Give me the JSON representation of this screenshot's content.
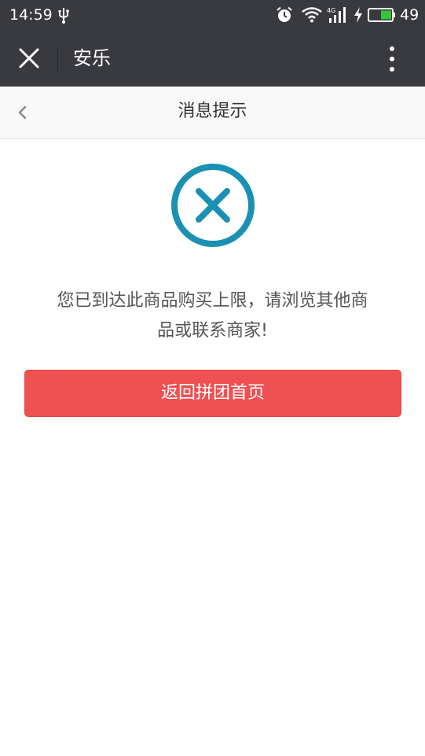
{
  "status_bar": {
    "time": "14:59",
    "battery_level": "49",
    "network_label": "4G",
    "icons": [
      "usb-icon",
      "alarm-icon",
      "wifi-icon",
      "signal-icon",
      "charging-bolt-icon",
      "battery-icon"
    ]
  },
  "app_bar": {
    "title": "安乐",
    "close_icon": "close-icon",
    "more_icon": "more-vertical-icon"
  },
  "page_nav": {
    "back_icon": "chevron-left-icon",
    "title": "消息提示"
  },
  "content": {
    "status_icon": "error-circle-x-icon",
    "message_line1": "您已到达此商品购买上限，请浏览其他商",
    "message_line2": "品或联系商家!",
    "button_label": "返回拼团首页"
  },
  "colors": {
    "status_bar_bg": "#393a3f",
    "nav_bg": "#f8f8f8",
    "error_icon": "#1a91b3",
    "button_bg": "#ef5051",
    "battery_fill": "#38c53a"
  }
}
